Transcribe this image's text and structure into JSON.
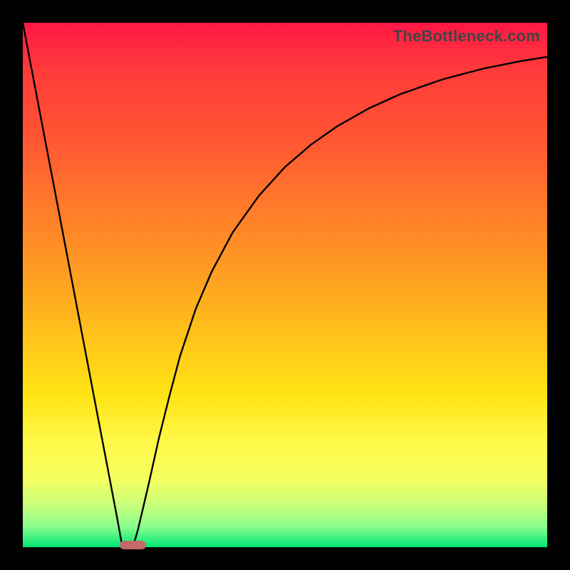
{
  "watermark": "TheBottleneck.com",
  "colors": {
    "frame": "#000000",
    "gradient_top": "#ff1744",
    "gradient_bottom": "#00e676",
    "curve": "#000000",
    "pill": "#c46a6a"
  },
  "chart_data": {
    "type": "line",
    "title": "",
    "xlabel": "",
    "ylabel": "",
    "xlim": [
      0,
      100
    ],
    "ylim": [
      0,
      100
    ],
    "x": [
      0,
      2,
      4,
      6,
      8,
      10,
      12,
      14,
      16,
      18,
      19,
      20,
      21,
      22,
      24,
      26,
      28,
      30,
      33,
      36,
      40,
      45,
      50,
      55,
      60,
      66,
      72,
      80,
      88,
      95,
      100
    ],
    "values": [
      100,
      89.5,
      79,
      68.5,
      58,
      47.5,
      37,
      26.5,
      16,
      5.5,
      0,
      0,
      0,
      3.5,
      12,
      21,
      29,
      36.5,
      45.5,
      52.5,
      60,
      67,
      72.5,
      76.8,
      80.3,
      83.7,
      86.4,
      89.2,
      91.3,
      92.7,
      93.5
    ],
    "marker": {
      "x_start": 18.5,
      "x_end": 23.5,
      "y": 0
    },
    "grid": false,
    "legend": false
  }
}
